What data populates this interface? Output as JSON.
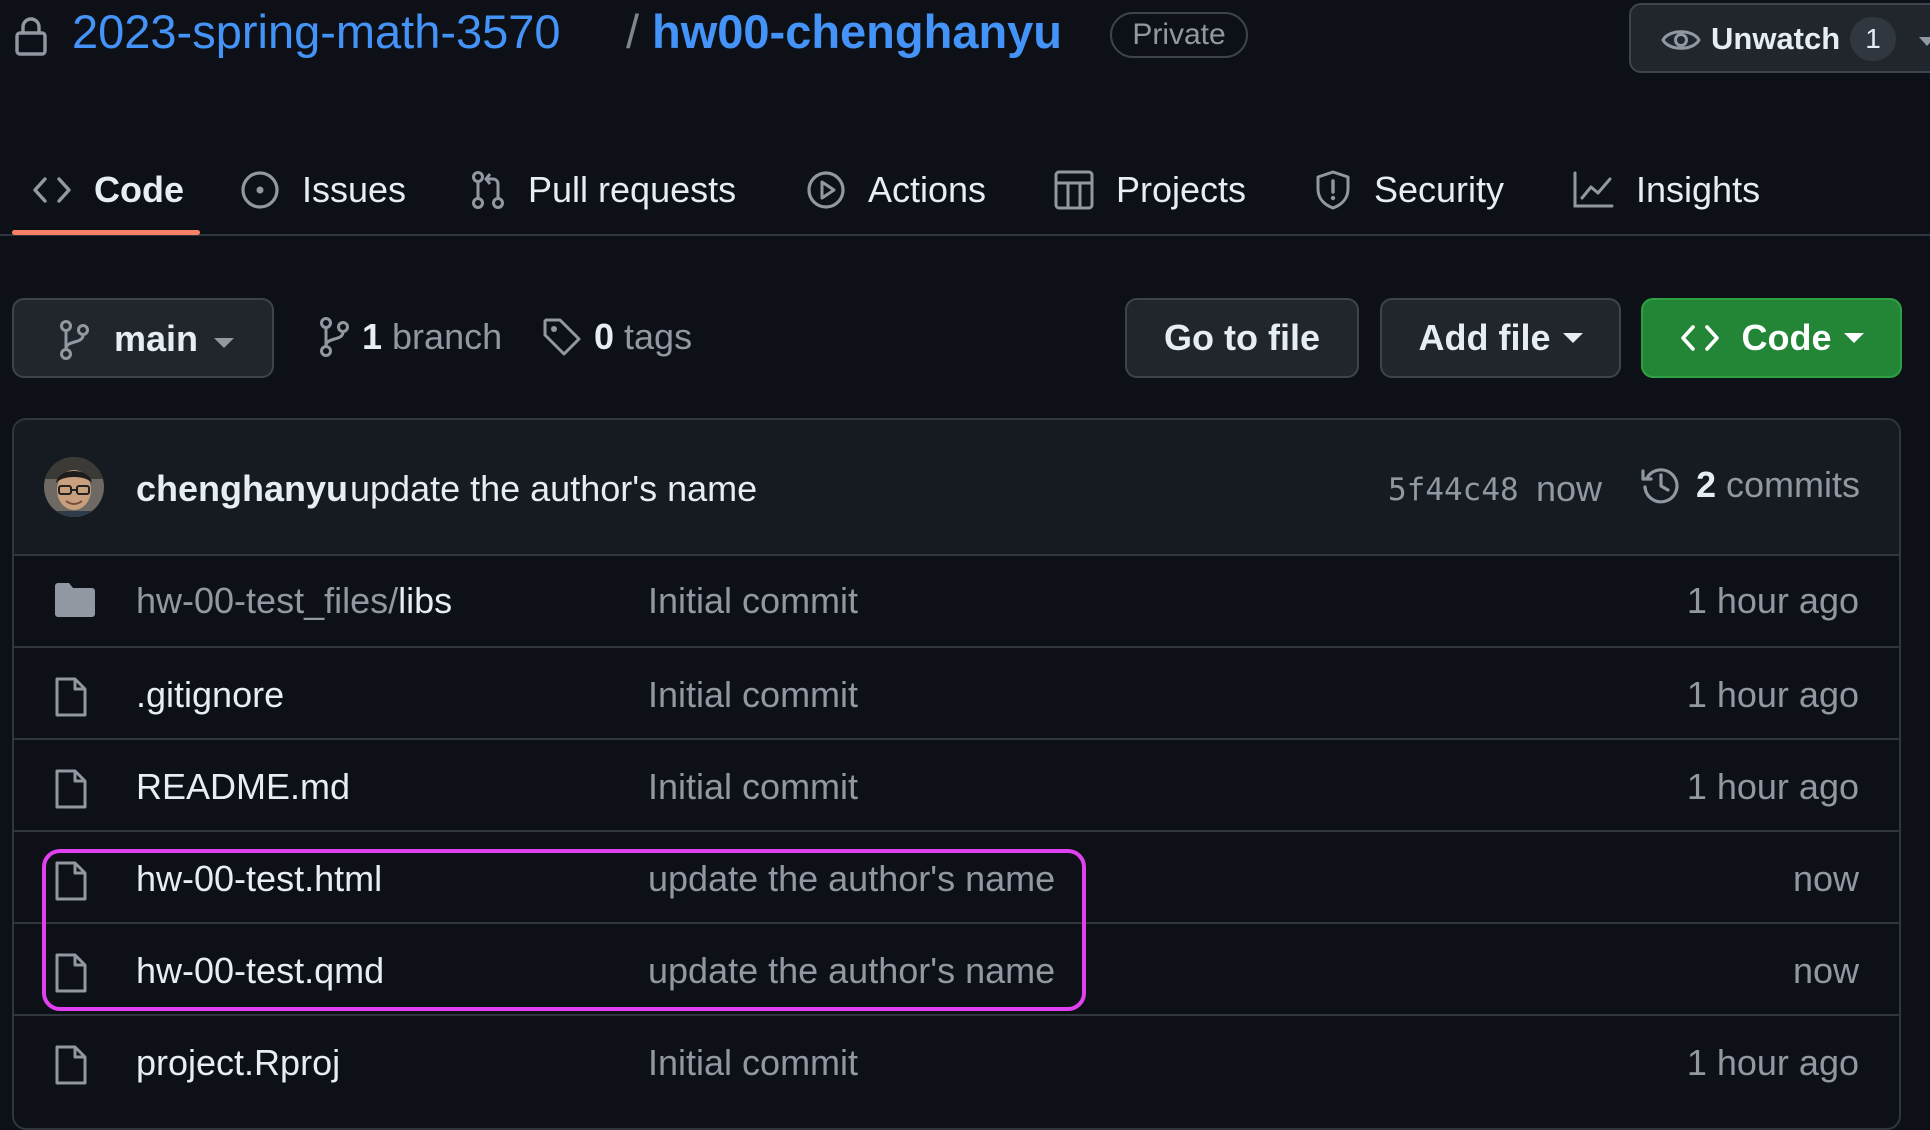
{
  "header": {
    "owner": "2023-spring-math-3570",
    "separator": "/",
    "repo": "hw00-chenghanyu",
    "visibility": "Private",
    "watch_label": "Unwatch",
    "watch_count": "1"
  },
  "tabs": [
    {
      "label": "Code",
      "icon": "code-icon",
      "active": true
    },
    {
      "label": "Issues",
      "icon": "issue-icon"
    },
    {
      "label": "Pull requests",
      "icon": "pull-request-icon"
    },
    {
      "label": "Actions",
      "icon": "play-icon"
    },
    {
      "label": "Projects",
      "icon": "table-icon"
    },
    {
      "label": "Security",
      "icon": "shield-icon"
    },
    {
      "label": "Insights",
      "icon": "graph-icon"
    }
  ],
  "toolbar": {
    "branch_name": "main",
    "branch_count": "1",
    "branch_label": "branch",
    "tag_count": "0",
    "tag_label": "tags",
    "go_to_file": "Go to file",
    "add_file": "Add file",
    "code_button": "Code"
  },
  "latest_commit": {
    "author": "chenghanyu",
    "message": "update the author's name",
    "sha": "5f44c48",
    "time": "now",
    "commit_count": "2",
    "commit_label": "commits"
  },
  "files": [
    {
      "type": "folder",
      "name_prefix": "hw-00-test_files/",
      "name": "libs",
      "message": "Initial commit",
      "age": "1 hour ago"
    },
    {
      "type": "file",
      "name_prefix": "",
      "name": ".gitignore",
      "message": "Initial commit",
      "age": "1 hour ago"
    },
    {
      "type": "file",
      "name_prefix": "",
      "name": "README.md",
      "message": "Initial commit",
      "age": "1 hour ago"
    },
    {
      "type": "file",
      "name_prefix": "",
      "name": "hw-00-test.html",
      "message": "update the author's name",
      "age": "now"
    },
    {
      "type": "file",
      "name_prefix": "",
      "name": "hw-00-test.qmd",
      "message": "update the author's name",
      "age": "now"
    },
    {
      "type": "file",
      "name_prefix": "",
      "name": "project.Rproj",
      "message": "Initial commit",
      "age": "1 hour ago"
    }
  ],
  "colors": {
    "background": "#0d1117",
    "link": "#4493f8",
    "accent_underline": "#f78166",
    "primary_button": "#238636",
    "highlight_box": "#e040f0"
  }
}
